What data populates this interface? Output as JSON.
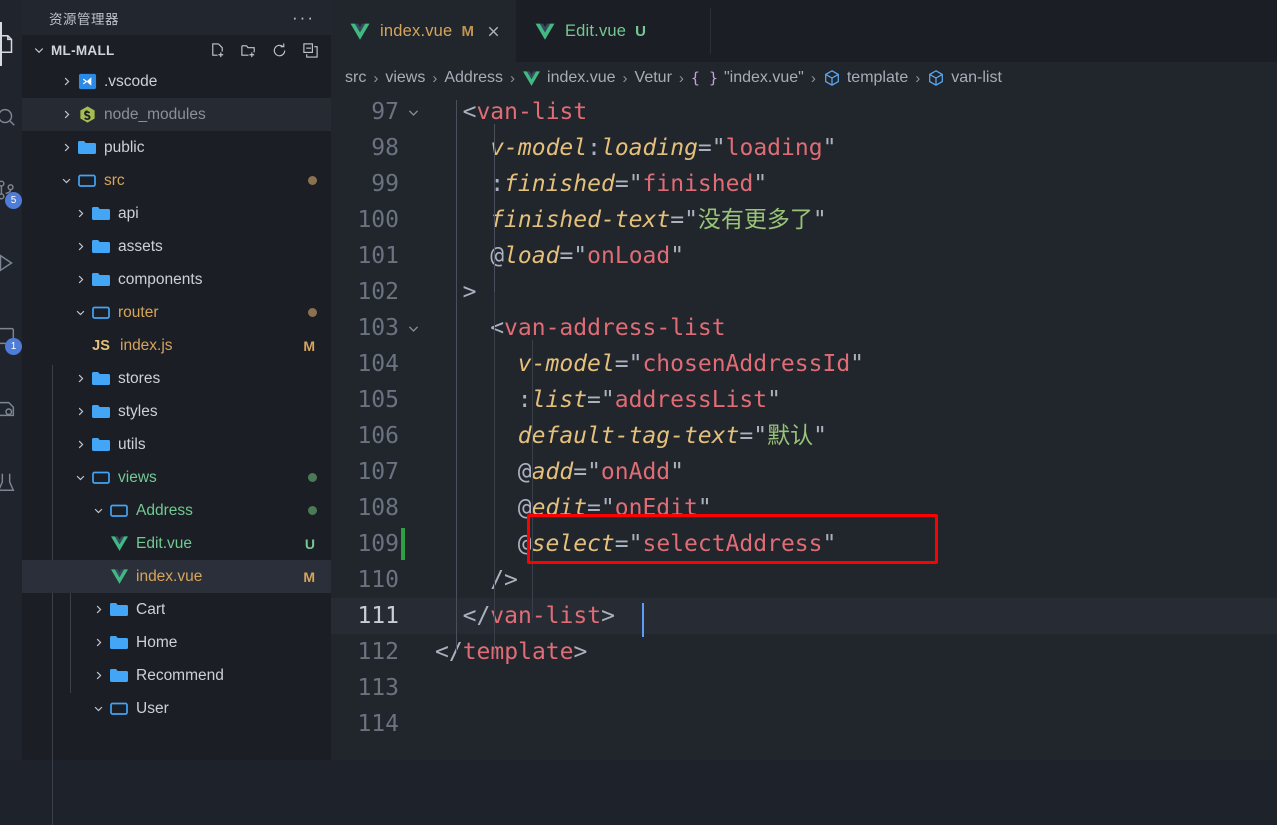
{
  "activitybar": {
    "items": [
      {
        "name": "explorer-icon",
        "label": "Explorer",
        "active": true,
        "badge": ""
      },
      {
        "name": "search-icon",
        "label": "Search",
        "active": false,
        "badge": ""
      },
      {
        "name": "source-control-icon",
        "label": "Source Control",
        "active": false,
        "badge": "5"
      },
      {
        "name": "run-debug-icon",
        "label": "Run and Debug",
        "active": false,
        "badge": ""
      },
      {
        "name": "extensions-icon",
        "label": "Extensions",
        "active": false,
        "badge": "1"
      },
      {
        "name": "remote-explorer-icon",
        "label": "Remote Explorer",
        "active": false,
        "badge": ""
      },
      {
        "name": "test-icon",
        "label": "Testing",
        "active": false,
        "badge": ""
      }
    ]
  },
  "sidebar": {
    "title": "资源管理器",
    "more_actions": "···",
    "root": {
      "name": "ML-MALL",
      "actions": [
        {
          "name": "new-file-icon",
          "label": "新建文件"
        },
        {
          "name": "new-folder-icon",
          "label": "新建文件夹"
        },
        {
          "name": "refresh-icon",
          "label": "刷新资源管理器"
        },
        {
          "name": "collapse-all-icon",
          "label": "在资源管理器中折叠文件夹"
        }
      ]
    },
    "tree": [
      {
        "label": ".vscode",
        "depth": 1,
        "type": "folder",
        "icon": "vscode-folder-icon",
        "twisty": "collapsed",
        "deco": "",
        "dot": "",
        "state": "normal"
      },
      {
        "label": "node_modules",
        "depth": 1,
        "type": "folder",
        "icon": "node-folder-icon",
        "twisty": "collapsed",
        "deco": "",
        "dot": "",
        "state": "hover"
      },
      {
        "label": "public",
        "depth": 1,
        "type": "folder",
        "icon": "folder-icon",
        "twisty": "collapsed",
        "deco": "",
        "dot": "",
        "state": "normal"
      },
      {
        "label": "src",
        "depth": 1,
        "type": "folder",
        "icon": "folder-open-icon",
        "twisty": "expanded",
        "deco": "",
        "dot": "#8a7250",
        "state": "modified"
      },
      {
        "label": "api",
        "depth": 2,
        "type": "folder",
        "icon": "folder-icon",
        "twisty": "collapsed",
        "deco": "",
        "dot": "",
        "state": "normal"
      },
      {
        "label": "assets",
        "depth": 2,
        "type": "folder",
        "icon": "folder-icon",
        "twisty": "collapsed",
        "deco": "",
        "dot": "",
        "state": "normal"
      },
      {
        "label": "components",
        "depth": 2,
        "type": "folder",
        "icon": "folder-icon",
        "twisty": "collapsed",
        "deco": "",
        "dot": "",
        "state": "normal"
      },
      {
        "label": "router",
        "depth": 2,
        "type": "folder",
        "icon": "folder-open-icon",
        "twisty": "expanded",
        "deco": "",
        "dot": "#8a7250",
        "state": "modified"
      },
      {
        "label": "index.js",
        "depth": 3,
        "type": "file",
        "icon": "js-file-icon",
        "twisty": "none",
        "deco": "M",
        "dot": "",
        "state": "modified"
      },
      {
        "label": "stores",
        "depth": 2,
        "type": "folder",
        "icon": "folder-icon",
        "twisty": "collapsed",
        "deco": "",
        "dot": "",
        "state": "normal"
      },
      {
        "label": "styles",
        "depth": 2,
        "type": "folder",
        "icon": "folder-icon",
        "twisty": "collapsed",
        "deco": "",
        "dot": "",
        "state": "normal"
      },
      {
        "label": "utils",
        "depth": 2,
        "type": "folder",
        "icon": "folder-icon",
        "twisty": "collapsed",
        "deco": "",
        "dot": "",
        "state": "normal"
      },
      {
        "label": "views",
        "depth": 2,
        "type": "folder",
        "icon": "folder-open-icon",
        "twisty": "expanded",
        "deco": "",
        "dot": "#4d7a56",
        "state": "untracked"
      },
      {
        "label": "Address",
        "depth": 3,
        "type": "folder",
        "icon": "folder-open-icon",
        "twisty": "expanded",
        "deco": "",
        "dot": "#4d7a56",
        "state": "untracked"
      },
      {
        "label": "Edit.vue",
        "depth": 4,
        "type": "file",
        "icon": "vue-file-icon",
        "twisty": "none",
        "deco": "U",
        "dot": "",
        "state": "untracked"
      },
      {
        "label": "index.vue",
        "depth": 4,
        "type": "file",
        "icon": "vue-file-icon",
        "twisty": "none",
        "deco": "M",
        "dot": "",
        "state": "selected"
      },
      {
        "label": "Cart",
        "depth": 3,
        "type": "folder",
        "icon": "folder-icon",
        "twisty": "collapsed",
        "deco": "",
        "dot": "",
        "state": "normal"
      },
      {
        "label": "Home",
        "depth": 3,
        "type": "folder",
        "icon": "folder-icon",
        "twisty": "collapsed",
        "deco": "",
        "dot": "",
        "state": "normal"
      },
      {
        "label": "Recommend",
        "depth": 3,
        "type": "folder",
        "icon": "folder-icon",
        "twisty": "collapsed",
        "deco": "",
        "dot": "",
        "state": "normal"
      },
      {
        "label": "User",
        "depth": 3,
        "type": "folder",
        "icon": "folder-open-icon",
        "twisty": "expanded",
        "deco": "",
        "dot": "",
        "state": "normal"
      }
    ]
  },
  "tabs": [
    {
      "label": "index.vue",
      "icon": "vue-file-icon",
      "dirty_badge": "M",
      "active": true,
      "close": "×",
      "badge_color": "#c09553"
    },
    {
      "label": "Edit.vue",
      "icon": "vue-file-icon",
      "dirty_badge": "U",
      "active": false,
      "close": "",
      "badge_color": "#73c991"
    }
  ],
  "breadcrumbs": [
    {
      "label": "src",
      "icon": ""
    },
    {
      "label": "views",
      "icon": ""
    },
    {
      "label": "Address",
      "icon": ""
    },
    {
      "label": "index.vue",
      "icon": "vue-file-icon"
    },
    {
      "label": "Vetur",
      "icon": ""
    },
    {
      "label": "\"index.vue\"",
      "icon": "braces-icon"
    },
    {
      "label": "template",
      "icon": "symbol-cube-icon"
    },
    {
      "label": "van-list",
      "icon": "symbol-cube-icon"
    }
  ],
  "editor": {
    "language": "vue",
    "active_line": 111,
    "modified_lines": [
      109
    ],
    "highlight_box": {
      "line": 109,
      "color": "#ff0000",
      "label": "select-event-highlight"
    },
    "lines": [
      {
        "num": "97",
        "fold": "expanded",
        "indent": 2,
        "tokens": [
          {
            "t": "punct",
            "v": "<"
          },
          {
            "t": "tag",
            "v": "van-list"
          }
        ]
      },
      {
        "num": "98",
        "fold": "",
        "indent": 4,
        "tokens": [
          {
            "t": "attr",
            "v": "v-model"
          },
          {
            "t": "punct",
            "v": ":"
          },
          {
            "t": "attr",
            "v": "loading"
          },
          {
            "t": "punct",
            "v": "="
          },
          {
            "t": "quote",
            "v": "\""
          },
          {
            "t": "val",
            "v": "loading"
          },
          {
            "t": "quote",
            "v": "\""
          }
        ]
      },
      {
        "num": "99",
        "fold": "",
        "indent": 4,
        "tokens": [
          {
            "t": "punct",
            "v": ":"
          },
          {
            "t": "attr",
            "v": "finished"
          },
          {
            "t": "punct",
            "v": "="
          },
          {
            "t": "quote",
            "v": "\""
          },
          {
            "t": "val",
            "v": "finished"
          },
          {
            "t": "quote",
            "v": "\""
          }
        ]
      },
      {
        "num": "100",
        "fold": "",
        "indent": 4,
        "tokens": [
          {
            "t": "attr",
            "v": "finished-text"
          },
          {
            "t": "punct",
            "v": "="
          },
          {
            "t": "quote",
            "v": "\""
          },
          {
            "t": "cn",
            "v": "没有更多了"
          },
          {
            "t": "quote",
            "v": "\""
          }
        ]
      },
      {
        "num": "101",
        "fold": "",
        "indent": 4,
        "tokens": [
          {
            "t": "punct",
            "v": "@"
          },
          {
            "t": "attr",
            "v": "load"
          },
          {
            "t": "punct",
            "v": "="
          },
          {
            "t": "quote",
            "v": "\""
          },
          {
            "t": "val",
            "v": "onLoad"
          },
          {
            "t": "quote",
            "v": "\""
          }
        ]
      },
      {
        "num": "102",
        "fold": "",
        "indent": 2,
        "tokens": [
          {
            "t": "punct",
            "v": ">"
          }
        ]
      },
      {
        "num": "103",
        "fold": "expanded",
        "indent": 4,
        "tokens": [
          {
            "t": "punct",
            "v": "<"
          },
          {
            "t": "tag",
            "v": "van-address-list"
          }
        ]
      },
      {
        "num": "104",
        "fold": "",
        "indent": 6,
        "tokens": [
          {
            "t": "attr",
            "v": "v-model"
          },
          {
            "t": "punct",
            "v": "="
          },
          {
            "t": "quote",
            "v": "\""
          },
          {
            "t": "val",
            "v": "chosenAddressId"
          },
          {
            "t": "quote",
            "v": "\""
          }
        ]
      },
      {
        "num": "105",
        "fold": "",
        "indent": 6,
        "tokens": [
          {
            "t": "punct",
            "v": ":"
          },
          {
            "t": "attr",
            "v": "list"
          },
          {
            "t": "punct",
            "v": "="
          },
          {
            "t": "quote",
            "v": "\""
          },
          {
            "t": "val",
            "v": "addressList"
          },
          {
            "t": "quote",
            "v": "\""
          }
        ]
      },
      {
        "num": "106",
        "fold": "",
        "indent": 6,
        "tokens": [
          {
            "t": "attr",
            "v": "default-tag-text"
          },
          {
            "t": "punct",
            "v": "="
          },
          {
            "t": "quote",
            "v": "\""
          },
          {
            "t": "cn",
            "v": "默认"
          },
          {
            "t": "quote",
            "v": "\""
          }
        ]
      },
      {
        "num": "107",
        "fold": "",
        "indent": 6,
        "tokens": [
          {
            "t": "punct",
            "v": "@"
          },
          {
            "t": "attr",
            "v": "add"
          },
          {
            "t": "punct",
            "v": "="
          },
          {
            "t": "quote",
            "v": "\""
          },
          {
            "t": "val",
            "v": "onAdd"
          },
          {
            "t": "quote",
            "v": "\""
          }
        ]
      },
      {
        "num": "108",
        "fold": "",
        "indent": 6,
        "tokens": [
          {
            "t": "punct",
            "v": "@"
          },
          {
            "t": "attr",
            "v": "edit"
          },
          {
            "t": "punct",
            "v": "="
          },
          {
            "t": "quote",
            "v": "\""
          },
          {
            "t": "val",
            "v": "onEdit"
          },
          {
            "t": "quote",
            "v": "\""
          }
        ]
      },
      {
        "num": "109",
        "fold": "",
        "indent": 6,
        "tokens": [
          {
            "t": "punct",
            "v": "@"
          },
          {
            "t": "attr",
            "v": "select"
          },
          {
            "t": "punct",
            "v": "="
          },
          {
            "t": "quote",
            "v": "\""
          },
          {
            "t": "val",
            "v": "selectAddress"
          },
          {
            "t": "quote",
            "v": "\""
          }
        ]
      },
      {
        "num": "110",
        "fold": "",
        "indent": 4,
        "tokens": [
          {
            "t": "punct",
            "v": "/>"
          }
        ]
      },
      {
        "num": "111",
        "fold": "",
        "indent": 2,
        "tokens": [
          {
            "t": "punct",
            "v": "</"
          },
          {
            "t": "tag",
            "v": "van-list"
          },
          {
            "t": "punct",
            "v": ">"
          }
        ]
      },
      {
        "num": "112",
        "fold": "",
        "indent": 0,
        "tokens": [
          {
            "t": "punct",
            "v": "</"
          },
          {
            "t": "tag",
            "v": "template"
          },
          {
            "t": "punct",
            "v": ">"
          }
        ]
      },
      {
        "num": "113",
        "fold": "",
        "indent": 0,
        "tokens": []
      },
      {
        "num": "114",
        "fold": "",
        "indent": 0,
        "tokens": []
      }
    ]
  }
}
